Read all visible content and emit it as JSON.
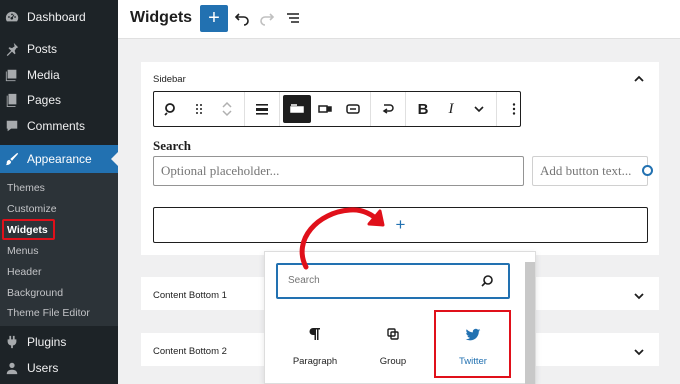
{
  "sidebar": {
    "menu": [
      {
        "label": "Dashboard",
        "icon": "dashboard-icon"
      },
      {
        "label": "Posts",
        "icon": "pin-icon"
      },
      {
        "label": "Media",
        "icon": "media-icon"
      },
      {
        "label": "Pages",
        "icon": "pages-icon"
      },
      {
        "label": "Comments",
        "icon": "comments-icon"
      },
      {
        "label": "Appearance",
        "icon": "brush-icon"
      },
      {
        "label": "Plugins",
        "icon": "plugin-icon"
      },
      {
        "label": "Users",
        "icon": "users-icon"
      }
    ],
    "submenu": [
      "Themes",
      "Customize",
      "Widgets",
      "Menus",
      "Header",
      "Background",
      "Theme File Editor"
    ]
  },
  "topbar": {
    "title": "Widgets",
    "add_label": "+"
  },
  "widget_area": {
    "title": "Sidebar",
    "search_label": "Search",
    "search_placeholder": "Optional placeholder...",
    "button_placeholder": "Add button text...",
    "appender_label": "+"
  },
  "areas": [
    {
      "title": "Content Bottom 1"
    },
    {
      "title": "Content Bottom 2"
    }
  ],
  "inserter": {
    "search_placeholder": "Search",
    "blocks": [
      {
        "label": "Paragraph",
        "icon": "paragraph-icon"
      },
      {
        "label": "Group",
        "icon": "group-icon"
      },
      {
        "label": "Twitter",
        "icon": "twitter-icon"
      }
    ]
  },
  "colors": {
    "admin_bg": "#1d2327",
    "submenu_bg": "#2c3338",
    "accent": "#2271b1",
    "highlight": "#e0101a"
  }
}
